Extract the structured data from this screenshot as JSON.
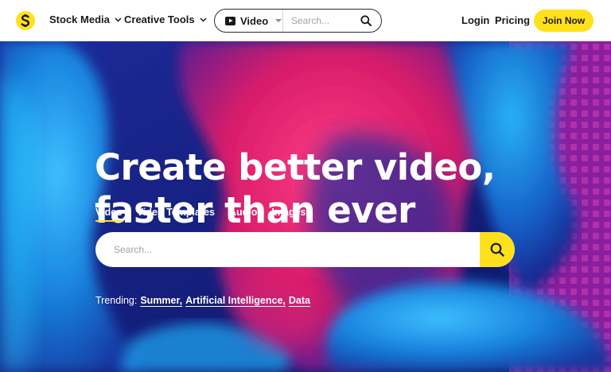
{
  "nav": {
    "menus": [
      {
        "label": "Stock Media"
      },
      {
        "label": "Creative Tools"
      }
    ],
    "search": {
      "type_label": "Video",
      "placeholder": "Search..."
    },
    "login_label": "Login",
    "pricing_label": "Pricing",
    "join_label": "Join Now"
  },
  "hero": {
    "headline_line1": "Create better video,",
    "headline_line2": "faster than ever",
    "tabs": [
      {
        "label": "Video",
        "active": true
      },
      {
        "label": "Video Templates",
        "active": false
      },
      {
        "label": "Audio",
        "active": false
      },
      {
        "label": "Images",
        "active": false
      }
    ],
    "search_placeholder": "Search...",
    "trending_label": "Trending:",
    "trending": [
      {
        "label": "Summer,"
      },
      {
        "label": "Artificial Intelligence,"
      },
      {
        "label": "Data"
      }
    ]
  },
  "colors": {
    "accent_yellow": "#ffe11b",
    "hero_blue": "#161d78",
    "hero_magenta": "#e0226f",
    "hero_cyan": "#1f9be8",
    "text_dark": "#1a1a1a"
  },
  "icons": [
    "logo-mark",
    "chevron-down-icon",
    "play-icon",
    "search-icon"
  ]
}
